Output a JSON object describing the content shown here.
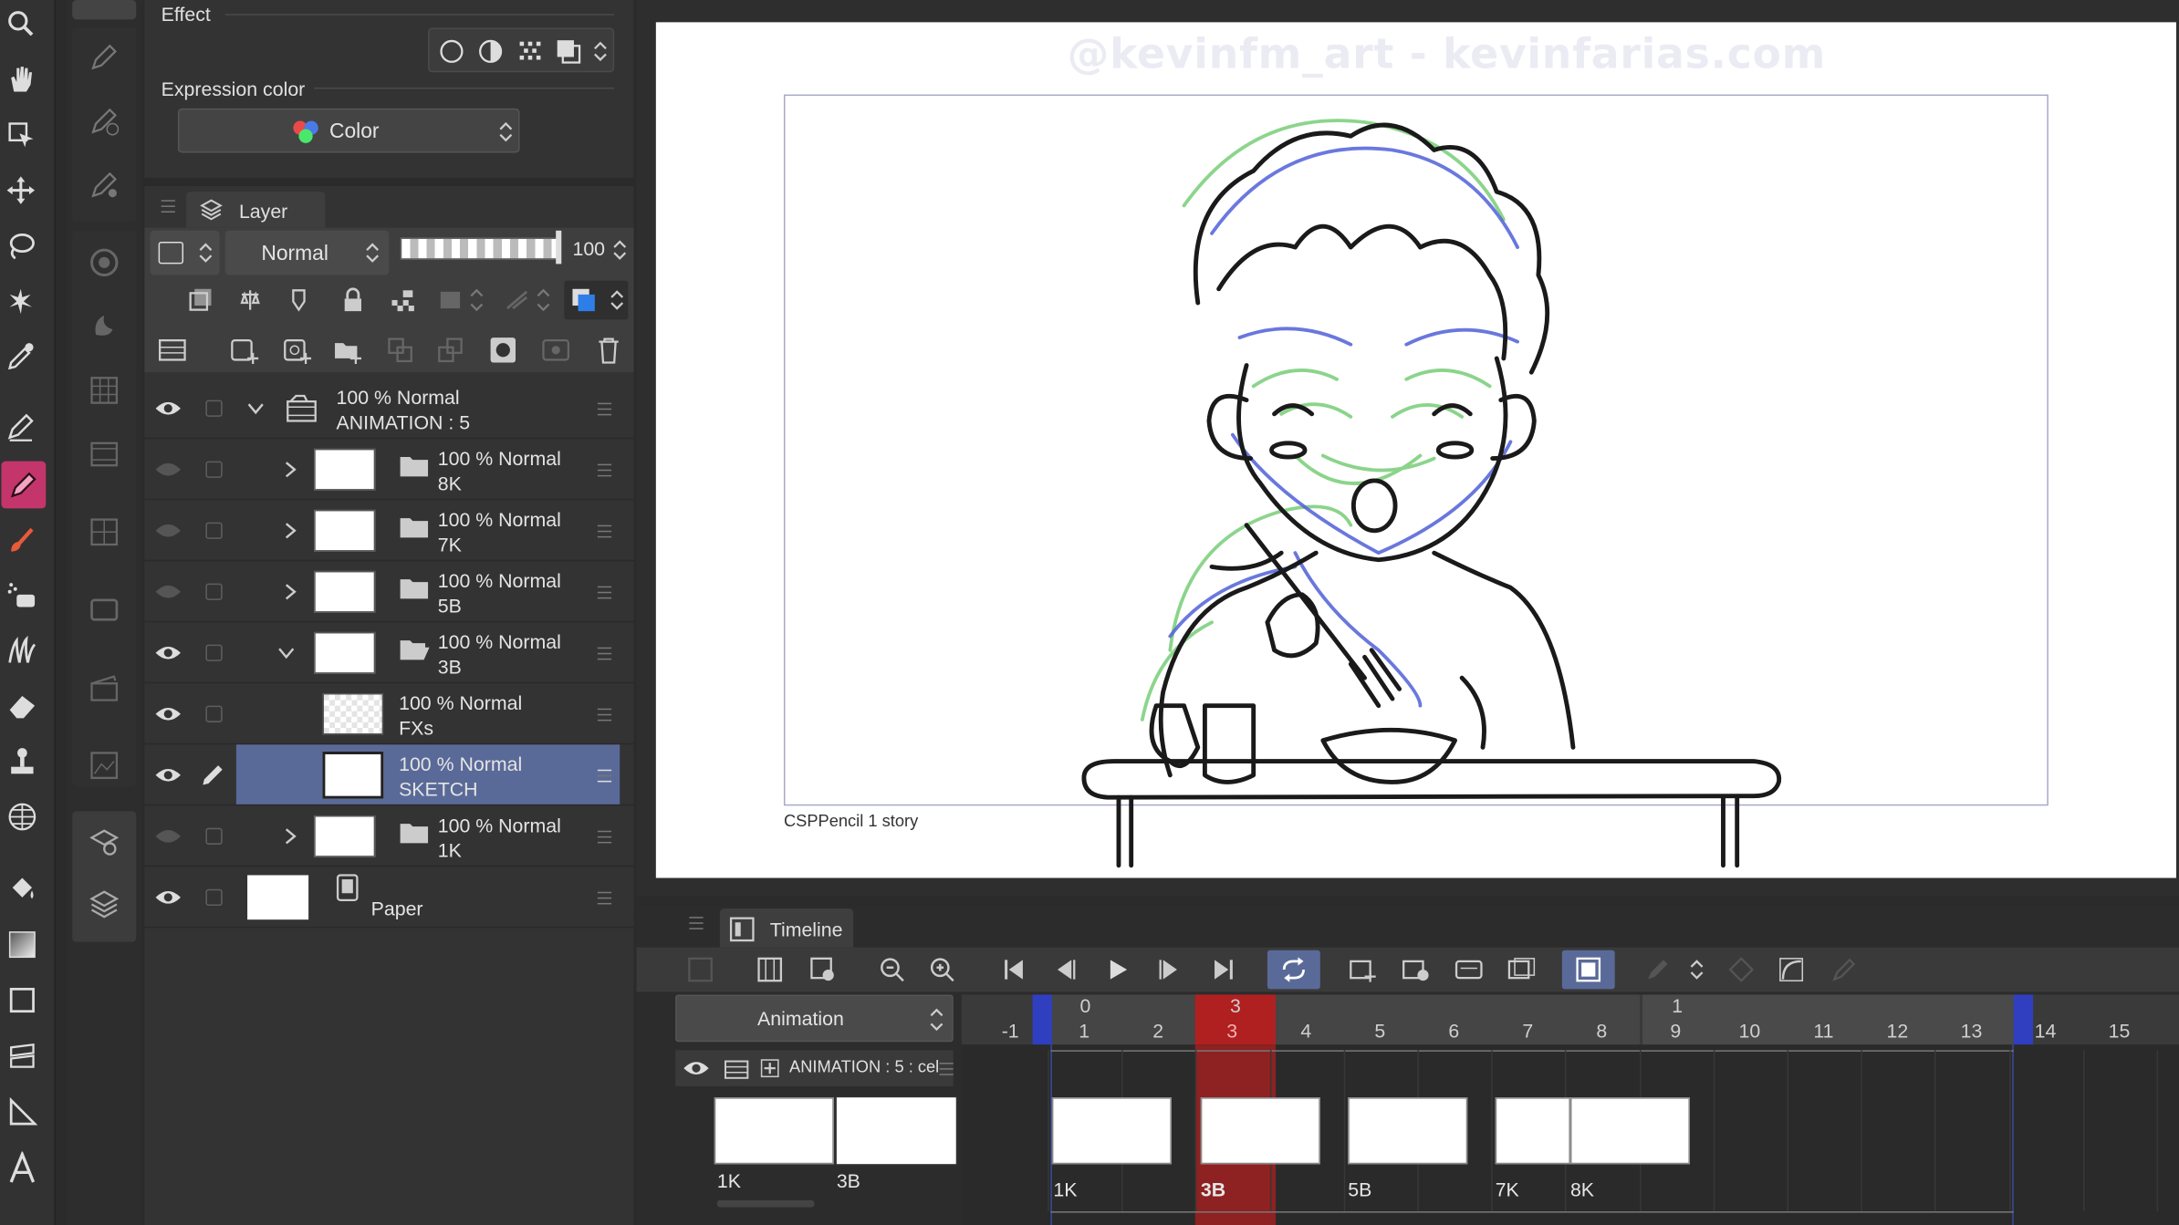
{
  "effect_panel": {
    "title": "Effect",
    "expression_color_label": "Expression color",
    "color_value": "Color"
  },
  "layer_panel": {
    "title": "Layer",
    "blend_mode": "Normal",
    "opacity": "100",
    "layers": [
      {
        "line1": "100 % Normal",
        "line2": "ANIMATION : 5"
      },
      {
        "line1": "100 % Normal",
        "line2": "8K"
      },
      {
        "line1": "100 % Normal",
        "line2": "7K"
      },
      {
        "line1": "100 % Normal",
        "line2": "5B"
      },
      {
        "line1": "100 % Normal",
        "line2": "3B"
      },
      {
        "line1": "100 % Normal",
        "line2": "FXs"
      },
      {
        "line1": "100 % Normal",
        "line2": "SKETCH"
      },
      {
        "line1": "100 % Normal",
        "line2": "1K"
      },
      {
        "line1": "",
        "line2": "Paper"
      }
    ]
  },
  "canvas": {
    "watermark": "@kevinfm_art - kevinfarias.com",
    "caption": "CSPPencil 1 story"
  },
  "timeline": {
    "title": "Timeline",
    "mode": "Animation",
    "track_name": "ANIMATION : 5 : cel",
    "frame_numbers": [
      "-1",
      "1",
      "2",
      "3",
      "4",
      "5",
      "6",
      "7",
      "8",
      "9",
      "10",
      "11",
      "12",
      "13",
      "14",
      "15"
    ],
    "marker_top": [
      "0",
      "3",
      "1"
    ],
    "cels": [
      "1K",
      "3B",
      "5B",
      "7K",
      "8K"
    ],
    "cel_list": [
      "1K",
      "3B"
    ],
    "current_frame": "3"
  },
  "colors": {
    "accent_blue": "#2f3fbf",
    "playhead_red": "#b02020",
    "selected_row": "#5a6a98"
  }
}
